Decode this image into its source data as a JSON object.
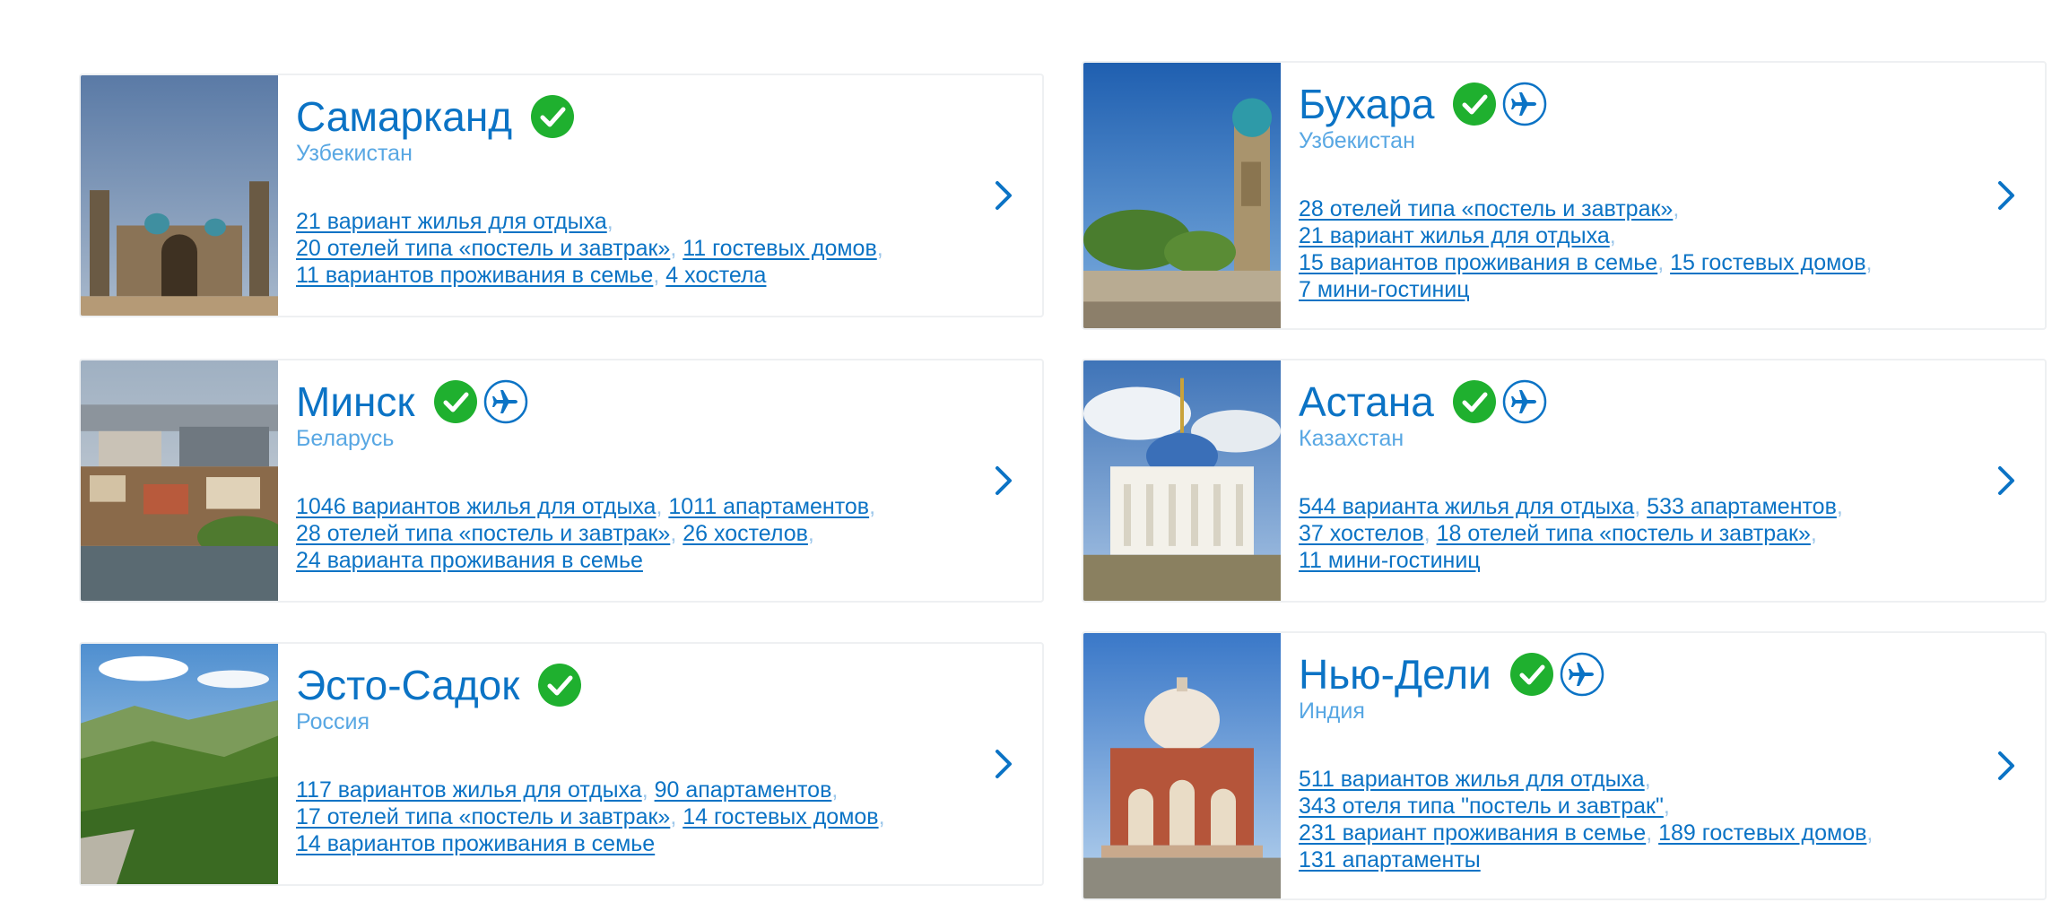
{
  "colors": {
    "link": "#0b73c5",
    "country": "#58a7e3",
    "verified_green": "#1fb02f",
    "plane_blue": "#0b73c5",
    "card_border": "#eef0f2"
  },
  "icons": {
    "verified": "check-circle-icon",
    "flights": "airplane-icon",
    "next": "chevron-right-icon"
  },
  "cards": [
    {
      "city": "Самарканд",
      "country": "Узбекистан",
      "badges": [
        "verified"
      ],
      "lines": [
        [
          "21 вариант жилья для отдыха"
        ],
        [
          "20 отелей типа «постель и завтрак»",
          "11 гостевых домов"
        ],
        [
          "11 вариантов проживания в семье",
          "4 хостела"
        ]
      ]
    },
    {
      "city": "Бухара",
      "country": "Узбекистан",
      "badges": [
        "verified",
        "flights"
      ],
      "lines": [
        [
          "28 отелей типа «постель и завтрак»"
        ],
        [
          "21 вариант жилья для отдыха"
        ],
        [
          "15 вариантов проживания в семье",
          "15 гостевых домов"
        ],
        [
          "7 мини-гостиниц"
        ]
      ]
    },
    {
      "city": "Минск",
      "country": "Беларусь",
      "badges": [
        "verified",
        "flights"
      ],
      "lines": [
        [
          "1046 вариантов жилья для отдыха",
          "1011 апартаментов"
        ],
        [
          "28 отелей типа «постель и завтрак»",
          "26 хостелов"
        ],
        [
          "24 варианта проживания в семье"
        ]
      ]
    },
    {
      "city": "Астана",
      "country": "Казахстан",
      "badges": [
        "verified",
        "flights"
      ],
      "lines": [
        [
          "544 варианта жилья для отдыха",
          "533 апартаментов"
        ],
        [
          "37 хостелов",
          "18 отелей типа «постель и завтрак»"
        ],
        [
          "11 мини-гостиниц"
        ]
      ]
    },
    {
      "city": "Эсто-Садок",
      "country": "Россия",
      "badges": [
        "verified"
      ],
      "lines": [
        [
          "117 вариантов жилья для отдыха",
          "90 апартаментов"
        ],
        [
          "17 отелей типа «постель и завтрак»",
          "14 гостевых домов"
        ],
        [
          "14 вариантов проживания в семье"
        ]
      ]
    },
    {
      "city": "Нью-Дели",
      "country": "Индия",
      "badges": [
        "verified",
        "flights"
      ],
      "lines": [
        [
          "511 вариантов жилья для отдыха"
        ],
        [
          "343 отеля типа \"постель и завтрак\""
        ],
        [
          "231 вариант проживания в семье",
          "189 гостевых домов"
        ],
        [
          "131 апартаменты"
        ]
      ]
    }
  ]
}
